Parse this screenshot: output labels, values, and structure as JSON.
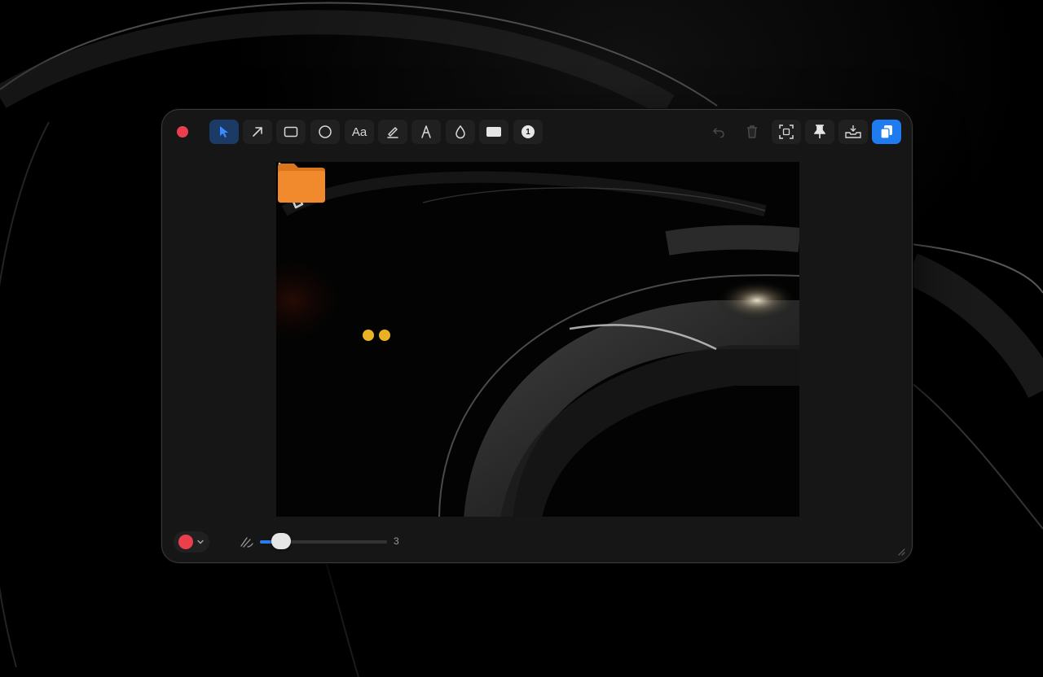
{
  "window": {
    "toolbar": {
      "tools": [
        {
          "name": "select",
          "icon": "cursor-arrow-icon",
          "active": true
        },
        {
          "name": "arrow",
          "icon": "arrow-icon"
        },
        {
          "name": "rectangle",
          "icon": "rectangle-icon"
        },
        {
          "name": "ellipse",
          "icon": "circle-icon"
        },
        {
          "name": "text",
          "icon": "text-icon",
          "label": "Aa"
        },
        {
          "name": "highlighter",
          "icon": "highlighter-icon"
        },
        {
          "name": "pen",
          "icon": "pen-icon"
        },
        {
          "name": "blur",
          "icon": "droplet-icon"
        },
        {
          "name": "fill",
          "icon": "filled-rect-icon"
        },
        {
          "name": "counter",
          "icon": "number-badge-icon",
          "label": "1"
        }
      ],
      "actions": [
        {
          "name": "undo",
          "icon": "undo-icon",
          "enabled": false
        },
        {
          "name": "delete",
          "icon": "trash-icon",
          "enabled": false
        },
        {
          "name": "ocr",
          "icon": "text-recognition-icon"
        },
        {
          "name": "pin",
          "icon": "pin-icon"
        },
        {
          "name": "save",
          "icon": "save-tray-icon"
        },
        {
          "name": "copy",
          "icon": "copy-icon",
          "primary": true
        }
      ]
    },
    "bottombar": {
      "color": "#ec3f4e",
      "stroke_width": {
        "value": 3,
        "min": 1,
        "max": 20,
        "label": "3"
      }
    }
  },
  "colors": {
    "accent": "#1f7cf0",
    "active_tool_bg": "#1b3a66",
    "close": "#ec3f4e",
    "folder": "#f08a2c"
  }
}
